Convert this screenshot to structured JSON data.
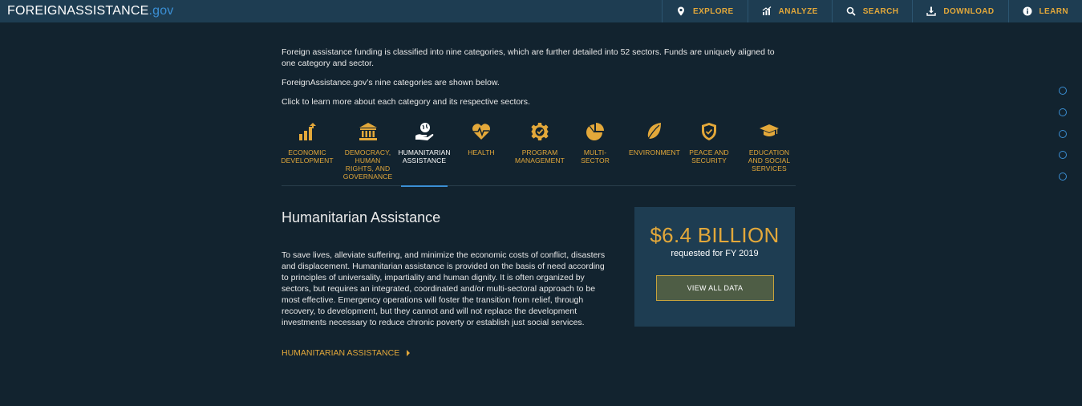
{
  "header": {
    "logo_main": "FOREIGNASSISTANCE",
    "logo_tld": ".gov",
    "nav": [
      {
        "label": "EXPLORE",
        "icon": "map-pin-icon"
      },
      {
        "label": "ANALYZE",
        "icon": "chart-icon"
      },
      {
        "label": "SEARCH",
        "icon": "search-icon"
      },
      {
        "label": "DOWNLOAD",
        "icon": "download-icon"
      },
      {
        "label": "LEARN",
        "icon": "info-icon"
      }
    ]
  },
  "intro": {
    "p1": "Foreign assistance funding is classified into nine categories, which are further detailed into 52 sectors. Funds are uniquely aligned to one category and sector.",
    "p2": "ForeignAssistance.gov’s nine categories are shown below.",
    "p3": "Click to learn more about each category and its respective sectors."
  },
  "categories": [
    {
      "label": "ECONOMIC DEVELOPMENT",
      "icon": "growth-chart-icon",
      "active": false
    },
    {
      "label": "DEMOCRACY, HUMAN RIGHTS, AND GOVERNANCE",
      "icon": "capitol-building-icon",
      "active": false
    },
    {
      "label": "HUMANITARIAN ASSISTANCE",
      "icon": "hand-globe-icon",
      "active": true
    },
    {
      "label": "HEALTH",
      "icon": "heart-pulse-icon",
      "active": false
    },
    {
      "label": "PROGRAM MANAGEMENT",
      "icon": "gear-check-icon",
      "active": false
    },
    {
      "label": "MULTI-SECTOR",
      "icon": "pie-chart-icon",
      "active": false
    },
    {
      "label": "ENVIRONMENT",
      "icon": "leaf-icon",
      "active": false
    },
    {
      "label": "PEACE AND SECURITY",
      "icon": "shield-check-icon",
      "active": false
    },
    {
      "label": "EDUCATION AND SOCIAL SERVICES",
      "icon": "graduation-cap-icon",
      "active": false
    }
  ],
  "detail": {
    "title": "Humanitarian Assistance",
    "description": "To save lives, alleviate suffering, and minimize the economic costs of conflict, disasters and displacement. Humanitarian assistance is provided on the basis of need according to principles of universality, impartiality and human dignity. It is often organized by sectors, but requires an integrated, coordinated and/or multi-sectoral approach to be most effective. Emergency operations will foster the transition from relief, through recovery, to development, but they cannot and will not replace the development investments necessary to reduce chronic poverty or establish just social services.",
    "link_label": "HUMANITARIAN ASSISTANCE"
  },
  "funding": {
    "amount": "$6.4 BILLION",
    "subtitle": "requested for FY 2019",
    "button_label": "VIEW ALL DATA"
  },
  "side_dots": 5,
  "colors": {
    "accent": "#e3a83a",
    "link_blue": "#3b8fd4",
    "background": "#12232f",
    "panel": "#1e3d52"
  }
}
